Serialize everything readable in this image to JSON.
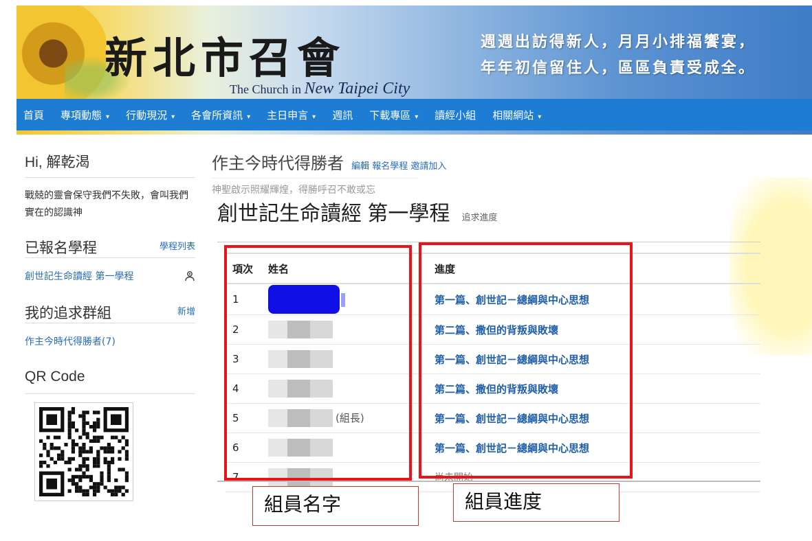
{
  "header": {
    "logo_cn": "新北市召會",
    "logo_en_prefix": "The Church in",
    "logo_en_city": "New Taipei City",
    "slogan_line1": "週週出訪得新人，月月小排福饗宴，",
    "slogan_line2": "年年初信留住人，區區負責受成全。"
  },
  "nav": {
    "items": [
      {
        "label": "首頁",
        "dropdown": false
      },
      {
        "label": "專項動態",
        "dropdown": true
      },
      {
        "label": "行動現況",
        "dropdown": true
      },
      {
        "label": "各會所資訊",
        "dropdown": true
      },
      {
        "label": "主日申言",
        "dropdown": true
      },
      {
        "label": "週訊",
        "dropdown": false
      },
      {
        "label": "下載專區",
        "dropdown": true
      },
      {
        "label": "讀經小組",
        "dropdown": false
      },
      {
        "label": "相關網站",
        "dropdown": true
      }
    ]
  },
  "sidebar": {
    "greeting": "Hi, 解乾渴",
    "motto": "戰兢的靈會保守我們不失敗，會叫我們實在的認識神",
    "enrolled_title": "已報名學程",
    "enrolled_link": "學程列表",
    "course_item": "創世記生命讀經 第一學程",
    "groups_title": "我的追求群組",
    "groups_link": "新增",
    "group_item": "作主今時代得勝者(7)",
    "qr_title": "QR Code"
  },
  "main": {
    "group_title": "作主今時代得勝者",
    "group_links": [
      "編輯",
      "報名學程",
      "邀請加入"
    ],
    "group_subtitle": "神聖啟示照耀輝煌，得勝呼召不敢或忘",
    "course_title": "創世記生命讀經 第一學程",
    "course_track": "追求進度",
    "table": {
      "headers": [
        "項次",
        "姓名",
        "進度"
      ],
      "rows": [
        {
          "no": "1",
          "role": "",
          "progress": "第一篇、創世記－總綱與中心思想",
          "link": true
        },
        {
          "no": "2",
          "role": "",
          "progress": "第二篇、撒但的背叛與敗壞",
          "link": true
        },
        {
          "no": "3",
          "role": "",
          "progress": "第一篇、創世記－總綱與中心思想",
          "link": true
        },
        {
          "no": "4",
          "role": "",
          "progress": "第二篇、撒但的背叛與敗壞",
          "link": true
        },
        {
          "no": "5",
          "role": "(組長)",
          "progress": "第一篇、創世記－總綱與中心思想",
          "link": true
        },
        {
          "no": "6",
          "role": "",
          "progress": "第一篇、創世記－總綱與中心思想",
          "link": true
        },
        {
          "no": "7",
          "role": "",
          "progress": "尚未開始",
          "link": false
        }
      ]
    }
  },
  "annotations": {
    "names_label": "組員名字",
    "progress_label": "組員進度",
    "highlight_color": "#e8141a"
  }
}
